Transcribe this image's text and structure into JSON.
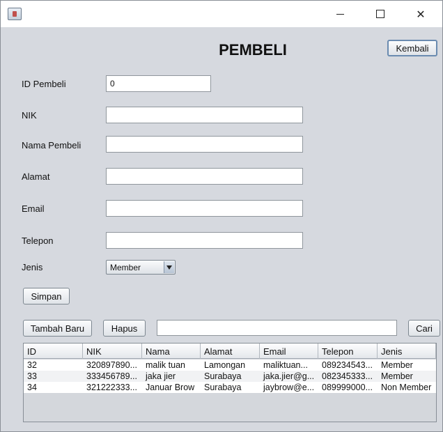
{
  "window": {
    "title_icon": "java-app-icon",
    "controls": {
      "minimize": "minimize-icon",
      "maximize": "maximize-icon",
      "close": "close-icon"
    }
  },
  "header": {
    "title": "PEMBELI",
    "back_label": "Kembali"
  },
  "form": {
    "id_label": "ID Pembeli",
    "id_value": "0",
    "nik_label": "NIK",
    "nik_value": "",
    "nama_label": "Nama Pembeli",
    "nama_value": "",
    "alamat_label": "Alamat",
    "alamat_value": "",
    "email_label": "Email",
    "email_value": "",
    "telepon_label": "Telepon",
    "telepon_value": "",
    "jenis_label": "Jenis",
    "jenis_selected": "Member",
    "save_label": "Simpan"
  },
  "actions": {
    "new_label": "Tambah Baru",
    "delete_label": "Hapus",
    "search_value": "",
    "search_label": "Cari"
  },
  "table": {
    "columns": [
      "ID",
      "NIK",
      "Nama",
      "Alamat",
      "Email",
      "Telepon",
      "Jenis"
    ],
    "rows": [
      [
        "32",
        "320897890...",
        "malik tuan",
        "Lamongan",
        "maliktuan...",
        "089234543...",
        "Member"
      ],
      [
        "33",
        "333456789...",
        "jaka jier",
        "Surabaya",
        "jaka.jier@g...",
        "082345333...",
        "Member"
      ],
      [
        "34",
        "321222333...",
        "Januar Brow",
        "Surabaya",
        "jaybrow@e...",
        "089999000...",
        "Non Member"
      ]
    ]
  }
}
